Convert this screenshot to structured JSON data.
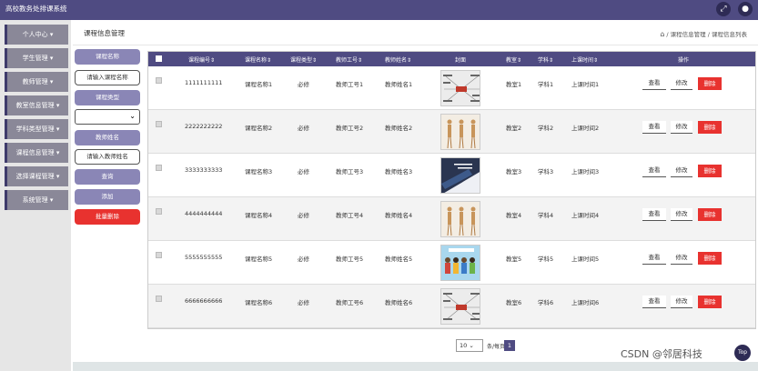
{
  "app": {
    "title": "高校教务处排课系统",
    "full_icon": "expand-icon",
    "user_icon": "user-icon",
    "accent": "#4f4b82"
  },
  "sidebar": {
    "items": [
      {
        "label": "个人中心 ▾"
      },
      {
        "label": "学生管理 ▾"
      },
      {
        "label": "教师管理 ▾"
      },
      {
        "label": "教室信息管理 ▾"
      },
      {
        "label": "学科类型管理 ▾"
      },
      {
        "label": "课程信息管理 ▾"
      },
      {
        "label": "选择课程管理 ▾"
      },
      {
        "label": "系统管理 ▾"
      }
    ]
  },
  "header": {
    "page_title": "课程信息管理",
    "breadcrumb_home": "⌂",
    "breadcrumb": "/ 课程信息管理 / 课程信息列表"
  },
  "search": {
    "course_name_label": "课程名称",
    "course_name_placeholder": "请输入课程名称",
    "course_type_label": "课程类型",
    "teacher_name_label": "教师姓名",
    "teacher_name_placeholder": "请输入教师姓名",
    "query_btn": "查询",
    "add_btn": "添加",
    "batch_delete_btn": "批量删除"
  },
  "table": {
    "headers": {
      "course_no": "课程编号",
      "course_name": "课程名称",
      "course_type": "课程类型",
      "teacher_no": "教师工号",
      "teacher_name": "教师姓名",
      "cover": "封面",
      "classroom": "教室",
      "subject": "学科",
      "time": "上课时间",
      "ops": "操作"
    },
    "sort_mark": "⇕",
    "view_label": "查看",
    "edit_label": "修改",
    "delete_label": "删除",
    "rows": [
      {
        "course_no": "1111111111",
        "course_name": "课程名称1",
        "course_type": "必修",
        "teacher_no": "教师工号1",
        "teacher_name": "教师姓名1",
        "classroom": "教室1",
        "subject": "学科1",
        "time": "上课时间1",
        "cover": "mindmap"
      },
      {
        "course_no": "2222222222",
        "course_name": "课程名称2",
        "course_type": "必修",
        "teacher_no": "教师工号2",
        "teacher_name": "教师姓名2",
        "classroom": "教室2",
        "subject": "学科2",
        "time": "上课时间2",
        "cover": "figures"
      },
      {
        "course_no": "3333333333",
        "course_name": "课程名称3",
        "course_type": "必修",
        "teacher_no": "教师工号3",
        "teacher_name": "教师姓名3",
        "classroom": "教室3",
        "subject": "学科3",
        "time": "上课时间3",
        "cover": "photo"
      },
      {
        "course_no": "4444444444",
        "course_name": "课程名称4",
        "course_type": "必修",
        "teacher_no": "教师工号4",
        "teacher_name": "教师姓名4",
        "classroom": "教室4",
        "subject": "学科4",
        "time": "上课时间4",
        "cover": "figures"
      },
      {
        "course_no": "5555555555",
        "course_name": "课程名称5",
        "course_type": "必修",
        "teacher_no": "教师工号5",
        "teacher_name": "教师姓名5",
        "classroom": "教室5",
        "subject": "学科5",
        "time": "上课时间5",
        "cover": "cartoon"
      },
      {
        "course_no": "6666666666",
        "course_name": "课程名称6",
        "course_type": "必修",
        "teacher_no": "教师工号6",
        "teacher_name": "教师姓名6",
        "classroom": "教室6",
        "subject": "学科6",
        "time": "上课时间6",
        "cover": "mindmap"
      }
    ]
  },
  "pager": {
    "page_size": "10",
    "per_page_label": "条/每页",
    "current_page": "1"
  },
  "watermark": "CSDN @邻居科技",
  "top_button": "Top"
}
